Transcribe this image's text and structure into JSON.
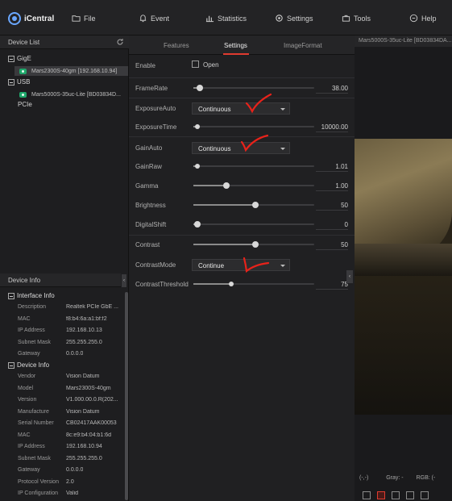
{
  "app": {
    "title": "iCentral"
  },
  "menu": [
    {
      "label": "File",
      "icon": "folder-icon"
    },
    {
      "label": "Event",
      "icon": "bell-icon"
    },
    {
      "label": "Statistics",
      "icon": "bar-chart-icon"
    },
    {
      "label": "Settings",
      "icon": "gear-icon"
    },
    {
      "label": "Tools",
      "icon": "toolbox-icon"
    },
    {
      "label": "Help",
      "icon": "help-icon"
    }
  ],
  "device_list": {
    "title": "Device List",
    "groups": [
      "GigE",
      "USB",
      "PCIe"
    ],
    "devices": [
      "Mars2300S-40gm [192.168.10.94]",
      "Mars5000S-35uc-Lite [BD03834D..."
    ]
  },
  "device_info": {
    "title": "Device Info",
    "interface_group": "Interface Info",
    "interface": [
      {
        "k": "Description",
        "v": "Realtek PCIe GbE ..."
      },
      {
        "k": "MAC",
        "v": "f8:b4:6a:a1:bf:f2"
      },
      {
        "k": "IP Address",
        "v": "192.168.10.13"
      },
      {
        "k": "Subnet Mask",
        "v": "255.255.255.0"
      },
      {
        "k": "Gateway",
        "v": "0.0.0.0"
      }
    ],
    "device_group": "Device Info",
    "device": [
      {
        "k": "Vendor",
        "v": "Vision Datum"
      },
      {
        "k": "Model",
        "v": "Mars2300S-40gm"
      },
      {
        "k": "Version",
        "v": "V1.000.00.0.R(202..."
      },
      {
        "k": "Manufacture",
        "v": "Vision Datum"
      },
      {
        "k": "Serial Number",
        "v": "CB02417AAK00053"
      },
      {
        "k": "MAC",
        "v": "8c:e9:b4:04:b1:6d"
      },
      {
        "k": "IP Address",
        "v": "192.168.10.94"
      },
      {
        "k": "Subnet Mask",
        "v": "255.255.255.0"
      },
      {
        "k": "Gateway",
        "v": "0.0.0.0"
      },
      {
        "k": "Protocol Version",
        "v": "2.0"
      },
      {
        "k": "IP Configuration",
        "v": "Valid"
      }
    ]
  },
  "tabs": [
    "Features",
    "Settings",
    "ImageFormat"
  ],
  "settings": {
    "enable": {
      "label": "Enable",
      "option": "Open"
    },
    "framerate": {
      "label": "FrameRate",
      "value": "38.00",
      "level": 0.04
    },
    "exposure_auto": {
      "label": "ExposureAuto",
      "value": "Continuous"
    },
    "exposure_time": {
      "label": "ExposureTime",
      "value": "10000.00",
      "level": 0.02
    },
    "gain_auto": {
      "label": "GainAuto",
      "value": "Continuous"
    },
    "gain_raw": {
      "label": "GainRaw",
      "value": "1.01",
      "level": 0.02
    },
    "gamma": {
      "label": "Gamma",
      "value": "1.00",
      "level": 0.26
    },
    "brightness": {
      "label": "Brightness",
      "value": "50",
      "level": 0.5
    },
    "digital_shift": {
      "label": "DigitalShift",
      "value": "0",
      "level": 0.02
    },
    "contrast": {
      "label": "Contrast",
      "value": "50",
      "level": 0.5
    },
    "contrast_mode": {
      "label": "ContrastMode",
      "value": "Continue"
    },
    "contrast_threshold": {
      "label": "ContrastThreshold",
      "value": "75",
      "level": 0.3
    }
  },
  "preview": {
    "title": "Mars5000S-35uc-Lite [BD03834DA...",
    "coords": "(-,-)",
    "gray": "Gray: -",
    "rgb": "RGB: (-"
  },
  "colors": {
    "accent": "#e03b2f",
    "annotation": "#e8221a",
    "camera": "#1fa86b"
  }
}
